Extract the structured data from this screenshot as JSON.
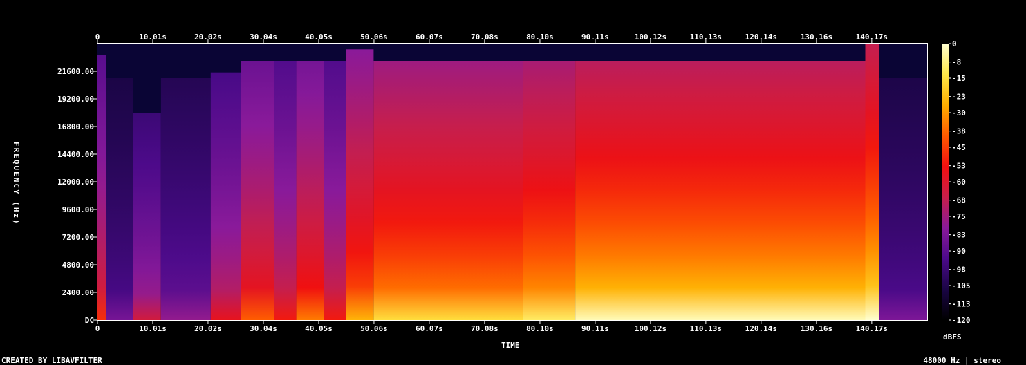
{
  "chart_data": {
    "type": "heatmap",
    "kind": "spectrogram",
    "xlabel": "TIME",
    "ylabel": "FREQUENCY (Hz)",
    "x_ticks": [
      "0",
      "10.01s",
      "20.02s",
      "30.04s",
      "40.05s",
      "50.06s",
      "60.07s",
      "70.08s",
      "80.10s",
      "90.11s",
      "100.12s",
      "110.13s",
      "120.14s",
      "130.16s",
      "140.17s"
    ],
    "x_tick_values": [
      0,
      10.01,
      20.02,
      30.04,
      40.05,
      50.06,
      60.07,
      70.08,
      80.1,
      90.11,
      100.12,
      110.13,
      120.14,
      130.16,
      140.17
    ],
    "xlim": [
      0,
      150.2
    ],
    "y_ticks": [
      "DC",
      "2400.00",
      "4800.00",
      "7200.00",
      "9600.00",
      "12000.00",
      "14400.00",
      "16800.00",
      "19200.00",
      "21600.00"
    ],
    "y_tick_values": [
      0,
      2400,
      4800,
      7200,
      9600,
      12000,
      14400,
      16800,
      19200,
      21600
    ],
    "ylim": [
      0,
      24000
    ],
    "colorbar": {
      "label": "dBFS",
      "ticks": [
        "0",
        "-8",
        "-15",
        "-23",
        "-30",
        "-38",
        "-45",
        "-53",
        "-60",
        "-68",
        "-75",
        "-83",
        "-90",
        "-98",
        "-105",
        "-113",
        "-120"
      ],
      "range": [
        -120,
        0
      ],
      "colormap": [
        "#000000",
        "#1a0545",
        "#4b0a8a",
        "#8a1a9a",
        "#c81e4a",
        "#f01010",
        "#ff5a00",
        "#ffae00",
        "#ffe84a",
        "#ffffd0"
      ]
    },
    "segments": [
      {
        "t0": 0,
        "t1": 1.5,
        "level": 0.55,
        "cutoff_hz": 23000
      },
      {
        "t0": 1.5,
        "t1": 6.5,
        "level": 0.25,
        "cutoff_hz": 21000
      },
      {
        "t0": 6.5,
        "t1": 11.5,
        "level": 0.42,
        "cutoff_hz": 18000
      },
      {
        "t0": 11.5,
        "t1": 20.5,
        "level": 0.3,
        "cutoff_hz": 21000
      },
      {
        "t0": 20.5,
        "t1": 26,
        "level": 0.48,
        "cutoff_hz": 21500
      },
      {
        "t0": 26,
        "t1": 32,
        "level": 0.62,
        "cutoff_hz": 22500
      },
      {
        "t0": 32,
        "t1": 36,
        "level": 0.52,
        "cutoff_hz": 22500
      },
      {
        "t0": 36,
        "t1": 41,
        "level": 0.66,
        "cutoff_hz": 22500
      },
      {
        "t0": 41,
        "t1": 45,
        "level": 0.52,
        "cutoff_hz": 22500
      },
      {
        "t0": 45,
        "t1": 50,
        "level": 0.74,
        "cutoff_hz": 23500
      },
      {
        "t0": 50,
        "t1": 77,
        "level": 0.82,
        "cutoff_hz": 22500
      },
      {
        "t0": 77,
        "t1": 86.5,
        "level": 0.86,
        "cutoff_hz": 22500
      },
      {
        "t0": 86.5,
        "t1": 139,
        "level": 0.93,
        "cutoff_hz": 22500
      },
      {
        "t0": 139,
        "t1": 141.5,
        "level": 0.97,
        "cutoff_hz": 24000
      },
      {
        "t0": 141.5,
        "t1": 150.2,
        "level": 0.26,
        "cutoff_hz": 21000
      }
    ]
  },
  "footer": {
    "credit": "CREATED BY LIBAVFILTER",
    "format": "48000 Hz | stereo"
  }
}
